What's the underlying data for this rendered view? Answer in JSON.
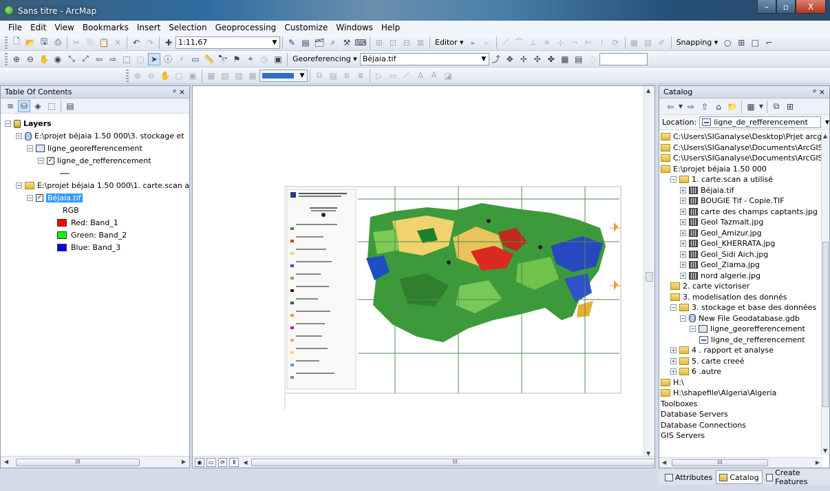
{
  "window": {
    "title": "Sans titre - ArcMap",
    "buttons": {
      "minimize": "–",
      "maximize": "▫",
      "close": "X"
    }
  },
  "menu": [
    "File",
    "Edit",
    "View",
    "Bookmarks",
    "Insert",
    "Selection",
    "Geoprocessing",
    "Customize",
    "Windows",
    "Help"
  ],
  "toolbar": {
    "scale": "1:11,67",
    "editor_label": "Editor ▾",
    "snapping_label": "Snapping ▾",
    "georef_label": "Georeferencing ▾",
    "georef_layer": "Béjaia.tif"
  },
  "toc": {
    "title": "Table Of Contents",
    "pin": "ᵖ ×",
    "layers_label": "Layers",
    "group1_path": "E:\\projet béjaia    1.50 000\\3. stockage et",
    "group1_sub": "ligne_georefferencement",
    "group1_layer": "ligne_de_refferencement",
    "group2_path": "E:\\projet béjaia    1.50 000\\1. carte.scan a",
    "raster_layer": "Béjaia.tif",
    "rgb_label": "RGB",
    "bands": [
      {
        "label": "Red:  Band_1",
        "color": "#ff0000"
      },
      {
        "label": "Green:  Band_2",
        "color": "#00ff00"
      },
      {
        "label": "Blue:  Band_3",
        "color": "#0000ff"
      }
    ]
  },
  "map": {
    "scroll_label": "III"
  },
  "catalog": {
    "title": "Catalog",
    "location_label": "Location:",
    "location_value": "ligne_de_refferencement",
    "items": [
      {
        "label": "C:\\Users\\SIGanalyse\\Desktop\\Prjet arcgis B",
        "type": "folder",
        "level": 0
      },
      {
        "label": "C:\\Users\\SIGanalyse\\Documents\\ArcGIS",
        "type": "folder",
        "level": 0
      },
      {
        "label": "C:\\Users\\SIGanalyse\\Documents\\ArcGIS\\De",
        "type": "folder",
        "level": 0
      },
      {
        "label": "E:\\projet béjaia    1.50 000",
        "type": "folder",
        "level": 0
      },
      {
        "label": "1. carte.scan a utilisé",
        "type": "folder",
        "level": 1,
        "expander": "⊟"
      },
      {
        "label": "Béjaia.tif",
        "type": "raster",
        "level": 2,
        "expander": "⊞"
      },
      {
        "label": "BOUGIE  Tif - Copie.TIF",
        "type": "raster",
        "level": 2,
        "expander": "⊞"
      },
      {
        "label": "carte des champs captants.jpg",
        "type": "raster",
        "level": 2,
        "expander": "⊞"
      },
      {
        "label": "Geol Tazmalt.jpg",
        "type": "raster",
        "level": 2,
        "expander": "⊞"
      },
      {
        "label": "Geol_Amizur.jpg",
        "type": "raster",
        "level": 2,
        "expander": "⊞"
      },
      {
        "label": "Geol_KHERRATA.jpg",
        "type": "raster",
        "level": 2,
        "expander": "⊞"
      },
      {
        "label": "Geol_Sidi Aich.jpg",
        "type": "raster",
        "level": 2,
        "expander": "⊞"
      },
      {
        "label": "Geol_Ziama.jpg",
        "type": "raster",
        "level": 2,
        "expander": "⊞"
      },
      {
        "label": "nord algerie.jpg",
        "type": "raster",
        "level": 2,
        "expander": "⊞"
      },
      {
        "label": "2. carte victoriser",
        "type": "folder",
        "level": 1
      },
      {
        "label": "3. modelisation des donnés",
        "type": "folder",
        "level": 1
      },
      {
        "label": "3. stockage et base des données",
        "type": "folder",
        "level": 1,
        "expander": "⊟"
      },
      {
        "label": "New File Geodatabase.gdb",
        "type": "db",
        "level": 2,
        "expander": "⊟"
      },
      {
        "label": "ligne_georefferencement",
        "type": "grp",
        "level": 3,
        "expander": "⊟"
      },
      {
        "label": "ligne_de_refferencement",
        "type": "line",
        "level": 4
      },
      {
        "label": "4 . rapport et analyse",
        "type": "folder",
        "level": 1,
        "expander": "⊞"
      },
      {
        "label": "5. carte creeé",
        "type": "folder",
        "level": 1,
        "expander": "⊞"
      },
      {
        "label": "6 .autre",
        "type": "folder",
        "level": 1,
        "expander": "⊞"
      },
      {
        "label": "H:\\",
        "type": "folder",
        "level": 0
      },
      {
        "label": "H:\\shapefile\\Algeria\\Algeria",
        "type": "folder",
        "level": 0
      },
      {
        "label": "Toolboxes",
        "type": "plain",
        "level": 0
      },
      {
        "label": "Database Servers",
        "type": "plain",
        "level": 0
      },
      {
        "label": "Database Connections",
        "type": "plain",
        "level": 0
      },
      {
        "label": "GIS Servers",
        "type": "plain",
        "level": 0
      }
    ]
  },
  "bottom_tabs": [
    "Attributes",
    "Catalog",
    "Create Features"
  ]
}
